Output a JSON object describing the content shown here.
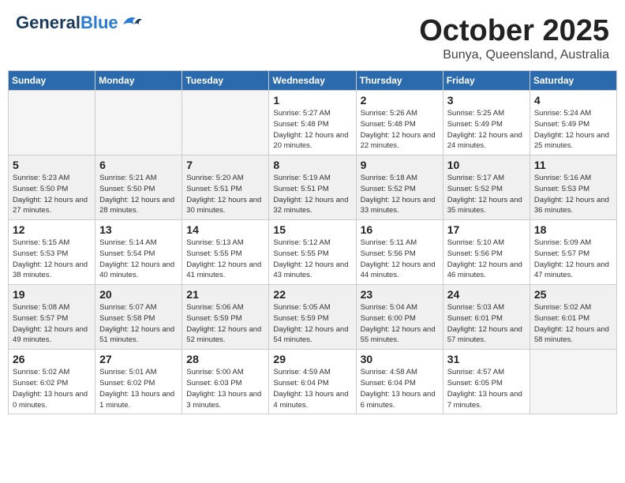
{
  "logo": {
    "text_general": "General",
    "text_blue": "Blue"
  },
  "header": {
    "month": "October 2025",
    "location": "Bunya, Queensland, Australia"
  },
  "weekdays": [
    "Sunday",
    "Monday",
    "Tuesday",
    "Wednesday",
    "Thursday",
    "Friday",
    "Saturday"
  ],
  "weeks": [
    [
      {
        "day": "",
        "empty": true
      },
      {
        "day": "",
        "empty": true
      },
      {
        "day": "",
        "empty": true
      },
      {
        "day": "1",
        "sunrise": "Sunrise: 5:27 AM",
        "sunset": "Sunset: 5:48 PM",
        "daylight": "Daylight: 12 hours and 20 minutes."
      },
      {
        "day": "2",
        "sunrise": "Sunrise: 5:26 AM",
        "sunset": "Sunset: 5:48 PM",
        "daylight": "Daylight: 12 hours and 22 minutes."
      },
      {
        "day": "3",
        "sunrise": "Sunrise: 5:25 AM",
        "sunset": "Sunset: 5:49 PM",
        "daylight": "Daylight: 12 hours and 24 minutes."
      },
      {
        "day": "4",
        "sunrise": "Sunrise: 5:24 AM",
        "sunset": "Sunset: 5:49 PM",
        "daylight": "Daylight: 12 hours and 25 minutes."
      }
    ],
    [
      {
        "day": "5",
        "sunrise": "Sunrise: 5:23 AM",
        "sunset": "Sunset: 5:50 PM",
        "daylight": "Daylight: 12 hours and 27 minutes."
      },
      {
        "day": "6",
        "sunrise": "Sunrise: 5:21 AM",
        "sunset": "Sunset: 5:50 PM",
        "daylight": "Daylight: 12 hours and 28 minutes."
      },
      {
        "day": "7",
        "sunrise": "Sunrise: 5:20 AM",
        "sunset": "Sunset: 5:51 PM",
        "daylight": "Daylight: 12 hours and 30 minutes."
      },
      {
        "day": "8",
        "sunrise": "Sunrise: 5:19 AM",
        "sunset": "Sunset: 5:51 PM",
        "daylight": "Daylight: 12 hours and 32 minutes."
      },
      {
        "day": "9",
        "sunrise": "Sunrise: 5:18 AM",
        "sunset": "Sunset: 5:52 PM",
        "daylight": "Daylight: 12 hours and 33 minutes."
      },
      {
        "day": "10",
        "sunrise": "Sunrise: 5:17 AM",
        "sunset": "Sunset: 5:52 PM",
        "daylight": "Daylight: 12 hours and 35 minutes."
      },
      {
        "day": "11",
        "sunrise": "Sunrise: 5:16 AM",
        "sunset": "Sunset: 5:53 PM",
        "daylight": "Daylight: 12 hours and 36 minutes."
      }
    ],
    [
      {
        "day": "12",
        "sunrise": "Sunrise: 5:15 AM",
        "sunset": "Sunset: 5:53 PM",
        "daylight": "Daylight: 12 hours and 38 minutes."
      },
      {
        "day": "13",
        "sunrise": "Sunrise: 5:14 AM",
        "sunset": "Sunset: 5:54 PM",
        "daylight": "Daylight: 12 hours and 40 minutes."
      },
      {
        "day": "14",
        "sunrise": "Sunrise: 5:13 AM",
        "sunset": "Sunset: 5:55 PM",
        "daylight": "Daylight: 12 hours and 41 minutes."
      },
      {
        "day": "15",
        "sunrise": "Sunrise: 5:12 AM",
        "sunset": "Sunset: 5:55 PM",
        "daylight": "Daylight: 12 hours and 43 minutes."
      },
      {
        "day": "16",
        "sunrise": "Sunrise: 5:11 AM",
        "sunset": "Sunset: 5:56 PM",
        "daylight": "Daylight: 12 hours and 44 minutes."
      },
      {
        "day": "17",
        "sunrise": "Sunrise: 5:10 AM",
        "sunset": "Sunset: 5:56 PM",
        "daylight": "Daylight: 12 hours and 46 minutes."
      },
      {
        "day": "18",
        "sunrise": "Sunrise: 5:09 AM",
        "sunset": "Sunset: 5:57 PM",
        "daylight": "Daylight: 12 hours and 47 minutes."
      }
    ],
    [
      {
        "day": "19",
        "sunrise": "Sunrise: 5:08 AM",
        "sunset": "Sunset: 5:57 PM",
        "daylight": "Daylight: 12 hours and 49 minutes."
      },
      {
        "day": "20",
        "sunrise": "Sunrise: 5:07 AM",
        "sunset": "Sunset: 5:58 PM",
        "daylight": "Daylight: 12 hours and 51 minutes."
      },
      {
        "day": "21",
        "sunrise": "Sunrise: 5:06 AM",
        "sunset": "Sunset: 5:59 PM",
        "daylight": "Daylight: 12 hours and 52 minutes."
      },
      {
        "day": "22",
        "sunrise": "Sunrise: 5:05 AM",
        "sunset": "Sunset: 5:59 PM",
        "daylight": "Daylight: 12 hours and 54 minutes."
      },
      {
        "day": "23",
        "sunrise": "Sunrise: 5:04 AM",
        "sunset": "Sunset: 6:00 PM",
        "daylight": "Daylight: 12 hours and 55 minutes."
      },
      {
        "day": "24",
        "sunrise": "Sunrise: 5:03 AM",
        "sunset": "Sunset: 6:01 PM",
        "daylight": "Daylight: 12 hours and 57 minutes."
      },
      {
        "day": "25",
        "sunrise": "Sunrise: 5:02 AM",
        "sunset": "Sunset: 6:01 PM",
        "daylight": "Daylight: 12 hours and 58 minutes."
      }
    ],
    [
      {
        "day": "26",
        "sunrise": "Sunrise: 5:02 AM",
        "sunset": "Sunset: 6:02 PM",
        "daylight": "Daylight: 13 hours and 0 minutes."
      },
      {
        "day": "27",
        "sunrise": "Sunrise: 5:01 AM",
        "sunset": "Sunset: 6:02 PM",
        "daylight": "Daylight: 13 hours and 1 minute."
      },
      {
        "day": "28",
        "sunrise": "Sunrise: 5:00 AM",
        "sunset": "Sunset: 6:03 PM",
        "daylight": "Daylight: 13 hours and 3 minutes."
      },
      {
        "day": "29",
        "sunrise": "Sunrise: 4:59 AM",
        "sunset": "Sunset: 6:04 PM",
        "daylight": "Daylight: 13 hours and 4 minutes."
      },
      {
        "day": "30",
        "sunrise": "Sunrise: 4:58 AM",
        "sunset": "Sunset: 6:04 PM",
        "daylight": "Daylight: 13 hours and 6 minutes."
      },
      {
        "day": "31",
        "sunrise": "Sunrise: 4:57 AM",
        "sunset": "Sunset: 6:05 PM",
        "daylight": "Daylight: 13 hours and 7 minutes."
      },
      {
        "day": "",
        "empty": true
      }
    ]
  ]
}
